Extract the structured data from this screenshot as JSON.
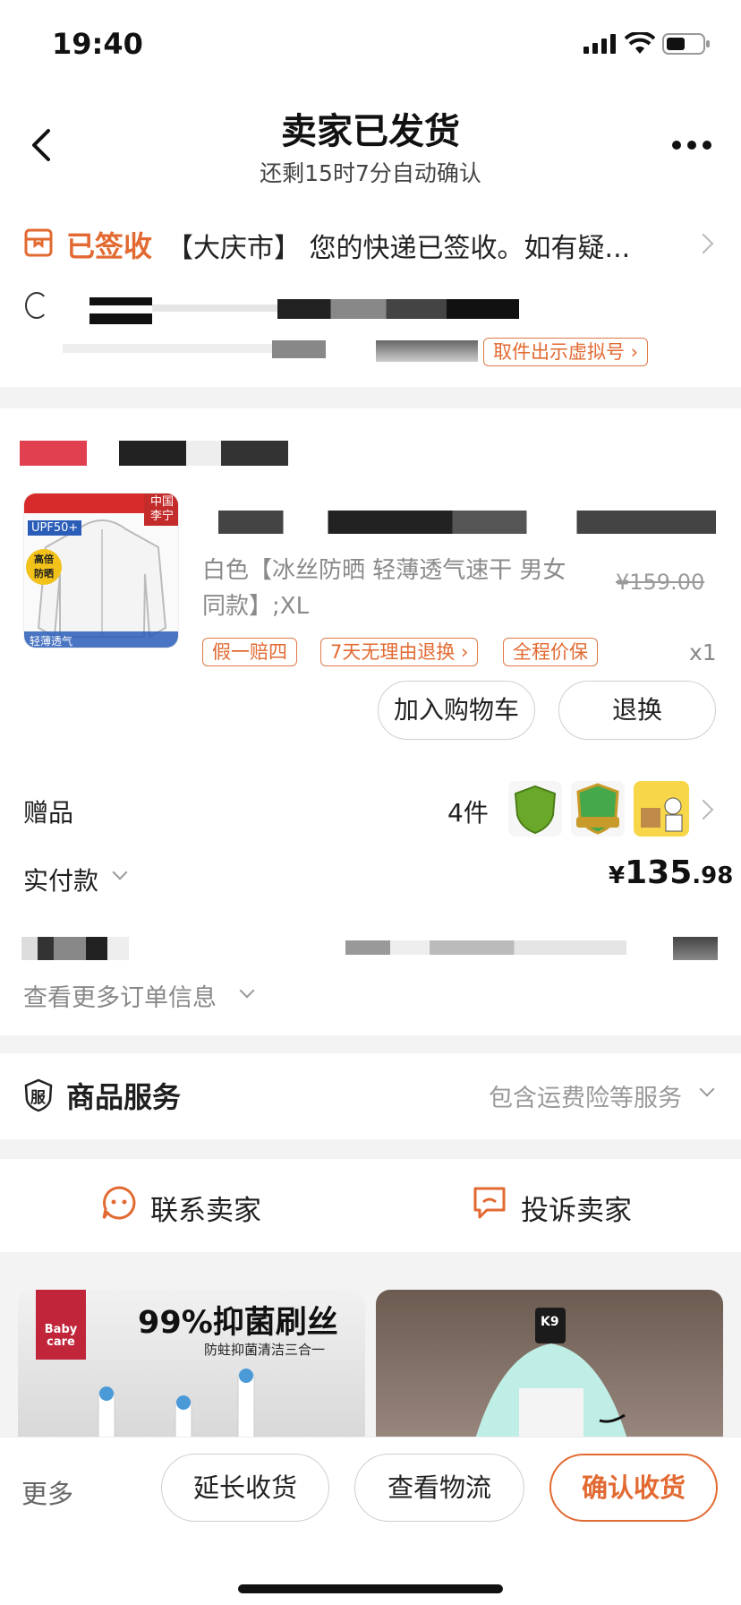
{
  "status_bar": {
    "time": "19:40"
  },
  "header": {
    "title": "卖家已发货",
    "subtitle": "还剩15时7分自动确认"
  },
  "logistics": {
    "status": "已签收",
    "message": "【大庆市】 您的快递已签收。如有疑...",
    "pickup_button": "取件出示虚拟号"
  },
  "product": {
    "thumb_badge_top": "中国\n李宁",
    "thumb_upf": "UPF50+",
    "thumb_badge_left": "高倍\n防晒",
    "thumb_bottom": "轻薄透气",
    "variant_line1": "白色【冰丝防晒 轻薄透气速干 男女",
    "variant_line2": "同款】;XL",
    "original_price": "¥159.00",
    "tags": [
      "假一赔四",
      "7天无理由退换",
      "全程价保"
    ],
    "quantity": "x1",
    "add_cart": "加入购物车",
    "return": "退换"
  },
  "gifts": {
    "label": "赠品",
    "count": "4件"
  },
  "payment": {
    "label": "实付款",
    "currency": "¥",
    "amount_int": "135",
    "amount_dec": ".98"
  },
  "order_more": "查看更多订单信息",
  "service": {
    "icon_text": "服",
    "title": "商品服务",
    "summary": "包含运费险等服务"
  },
  "contact": {
    "seller": "联系卖家",
    "complain": "投诉卖家"
  },
  "ads": [
    {
      "logo": "Baby\ncare",
      "headline": "99%抑菌刷丝",
      "sub": "防蛀抑菌清洁三合一"
    },
    {
      "label": "K9"
    }
  ],
  "bottom_bar": {
    "more": "更多",
    "extend": "延长收货",
    "logistics": "查看物流",
    "confirm": "确认收货"
  },
  "colors": {
    "accent": "#e26a32",
    "background": "#f3f3f3"
  }
}
